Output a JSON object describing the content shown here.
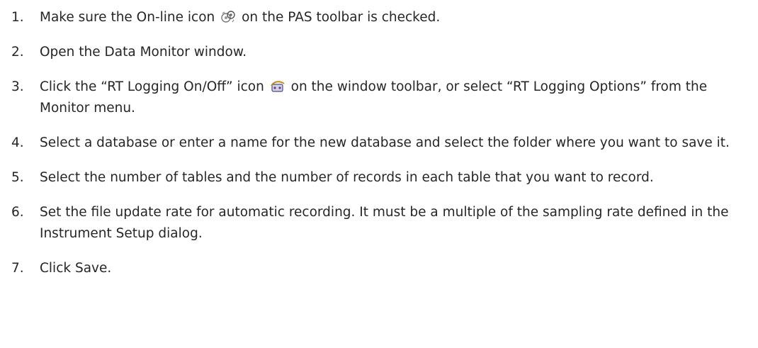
{
  "steps": [
    {
      "number": "1.",
      "text_before": "Make sure the On-line icon",
      "icon": "online-icon",
      "text_after": "on the PAS toolbar is checked."
    },
    {
      "number": "2.",
      "text": "Open the Data Monitor window."
    },
    {
      "number": "3.",
      "text_before": "Click the “RT Logging On/Off” icon",
      "icon": "rt-logging-icon",
      "text_after": "on the window toolbar, or select “RT Logging Options” from the Monitor menu."
    },
    {
      "number": "4.",
      "text": "Select a database or enter a name for the new database and select the folder where you want to save it."
    },
    {
      "number": "5.",
      "text": "Select the number of tables and the number of records in each table that you want to record."
    },
    {
      "number": "6.",
      "text": "Set the file update rate for automatic recording. It must be a multiple of the sampling rate defined in the Instrument Setup dialog."
    },
    {
      "number": "7.",
      "text": "Click Save."
    }
  ]
}
